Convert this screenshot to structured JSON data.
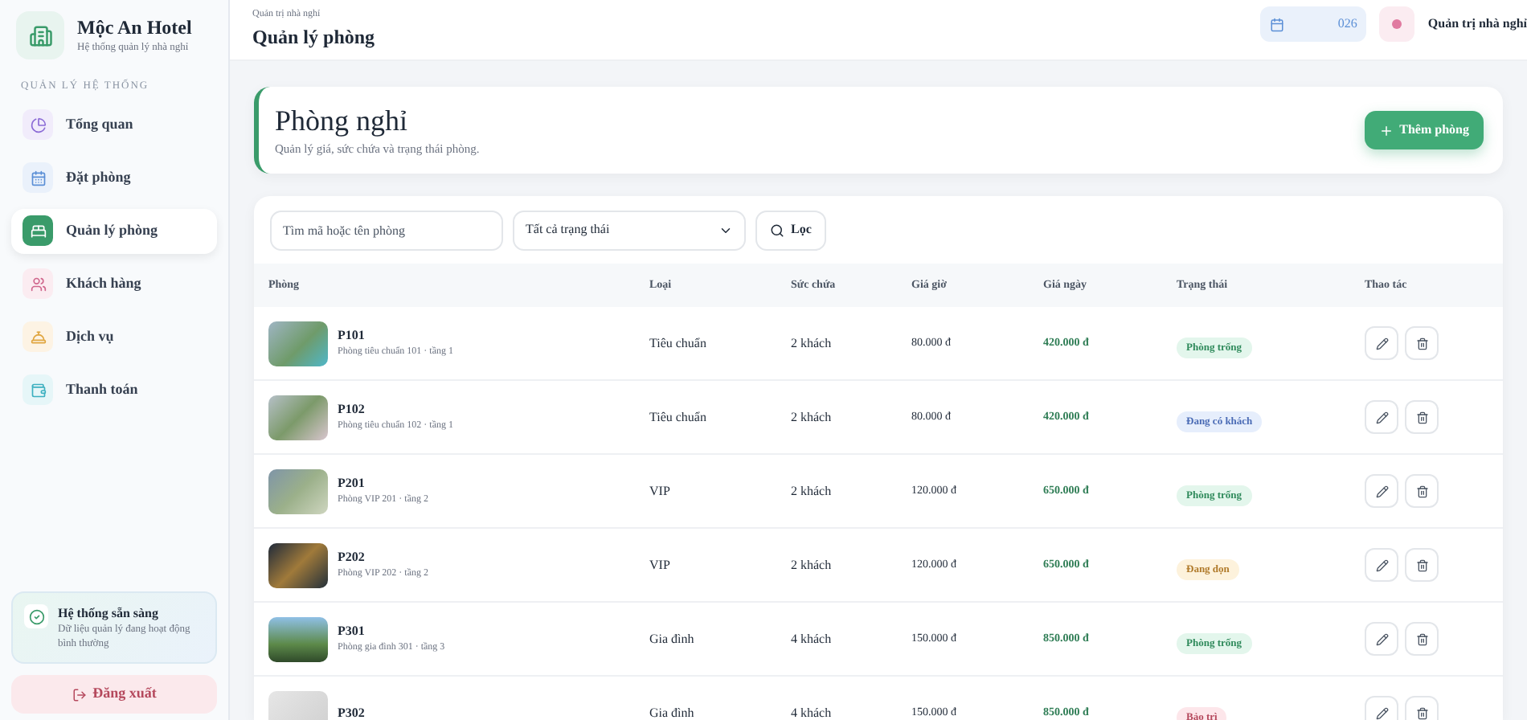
{
  "sidebar": {
    "brand": {
      "name": "Mộc An Hotel",
      "subtitle": "Hệ thống quản lý nhà nghỉ"
    },
    "section_label": "QUẢN LÝ HỆ THỐNG",
    "items": [
      {
        "label": "Tổng quan",
        "selected": false
      },
      {
        "label": "Đặt phòng",
        "selected": false
      },
      {
        "label": "Quản lý phòng",
        "selected": true
      },
      {
        "label": "Khách hàng",
        "selected": false
      },
      {
        "label": "Dịch vụ",
        "selected": false
      },
      {
        "label": "Thanh toán",
        "selected": false
      }
    ],
    "status_card": {
      "title": "Hệ thống sẵn sàng",
      "text": "Dữ liệu quản lý đang hoạt động bình thường"
    },
    "logout": "Đăng xuất"
  },
  "header": {
    "breadcrumb": "Quản trị nhà nghỉ",
    "title": "Quản lý phòng",
    "date": "026",
    "user": "Quản trị nhà nghỉ"
  },
  "hero": {
    "title": "Phòng nghỉ",
    "subtitle": "Quản lý giá, sức chứa và trạng thái phòng.",
    "button": "Thêm phòng"
  },
  "filters": {
    "search_placeholder": "Tìm mã hoặc tên phòng",
    "status_select": "Tất cả trạng thái",
    "filter_button": "Lọc"
  },
  "table": {
    "columns": [
      "Phòng",
      "Loại",
      "Sức chứa",
      "Giá giờ",
      "Giá ngày",
      "Trạng thái",
      "Thao tác"
    ],
    "rows": [
      {
        "code": "P101",
        "desc": "Phòng tiêu chuẩn 101 · tầng 1",
        "type": "Tiêu chuẩn",
        "capacity": "2 khách",
        "hour_price": "80.000 đ",
        "day_price": "420.000 đ",
        "status": {
          "label": "Phòng trống",
          "kind": "available"
        }
      },
      {
        "code": "P102",
        "desc": "Phòng tiêu chuẩn 102 · tầng 1",
        "type": "Tiêu chuẩn",
        "capacity": "2 khách",
        "hour_price": "80.000 đ",
        "day_price": "420.000 đ",
        "status": {
          "label": "Đang có khách",
          "kind": "occupied"
        }
      },
      {
        "code": "P201",
        "desc": "Phòng VIP 201 · tầng 2",
        "type": "VIP",
        "capacity": "2 khách",
        "hour_price": "120.000 đ",
        "day_price": "650.000 đ",
        "status": {
          "label": "Phòng trống",
          "kind": "available"
        }
      },
      {
        "code": "P202",
        "desc": "Phòng VIP 202 · tầng 2",
        "type": "VIP",
        "capacity": "2 khách",
        "hour_price": "120.000 đ",
        "day_price": "650.000 đ",
        "status": {
          "label": "Đang dọn",
          "kind": "cleaning"
        }
      },
      {
        "code": "P301",
        "desc": "Phòng gia đình 301 · tầng 3",
        "type": "Gia đình",
        "capacity": "4 khách",
        "hour_price": "150.000 đ",
        "day_price": "850.000 đ",
        "status": {
          "label": "Phòng trống",
          "kind": "available"
        }
      },
      {
        "code": "P302",
        "type": "Gia đình",
        "capacity": "4 khách",
        "hour_price": "150.000 đ",
        "day_price": "850.000 đ",
        "status": {
          "label": "Bảo trì",
          "kind": "maintenance"
        }
      }
    ]
  }
}
